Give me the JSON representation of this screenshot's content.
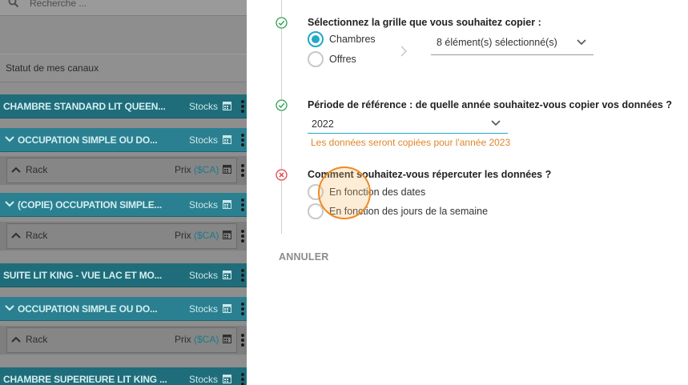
{
  "left_panel": {
    "search_placeholder": "Recherche ...",
    "status_label": "Statut de mes canaux",
    "rows": [
      {
        "kind": "room",
        "title": "CHAMBRE STANDARD LIT QUEEN...",
        "stock_label": "Stocks"
      },
      {
        "kind": "occupancy",
        "title": "OCCUPATION SIMPLE OU DO...",
        "stock_label": "Stocks"
      },
      {
        "kind": "rate",
        "label": "Rack",
        "price_label": "Prix",
        "currency": "($CA)"
      },
      {
        "kind": "occupancy",
        "title": "(COPIE) OCCUPATION SIMPLE...",
        "stock_label": "Stocks"
      },
      {
        "kind": "rate",
        "label": "Rack",
        "price_label": "Prix",
        "currency": "($CA)"
      },
      {
        "kind": "room",
        "title": "SUITE LIT KING - VUE LAC ET MO...",
        "stock_label": "Stocks"
      },
      {
        "kind": "occupancy",
        "title": "OCCUPATION SIMPLE OU DO...",
        "stock_label": "Stocks"
      },
      {
        "kind": "rate",
        "label": "Rack",
        "price_label": "Prix",
        "currency": "($CA)"
      },
      {
        "kind": "room",
        "title": "CHAMBRE SUPERIEURE LIT KING ...",
        "stock_label": "Stocks"
      }
    ]
  },
  "dialog": {
    "step1": {
      "title": "Sélectionnez la grille que vous souhaitez copier :",
      "options": [
        "Chambres",
        "Offres"
      ],
      "selected_option": "Chambres",
      "selection_value": "8 élément(s) sélectionné(s)",
      "status": "done"
    },
    "step2": {
      "title": "Période de référence : de quelle année souhaitez-vous copier vos données ?",
      "year_value": "2022",
      "hint": "Les données seront copiées pour l'année 2023",
      "status": "done"
    },
    "step3": {
      "title": "Comment souhaitez-vous répercuter les données ?",
      "options": [
        "En fonction des dates",
        "En fonction des jours de la semaine"
      ],
      "status": "error"
    },
    "cancel_label": "ANNULER"
  },
  "colors": {
    "accent": "#23a8c7",
    "success": "#2e9e4f",
    "error": "#e0434c",
    "hint": "#e0852a",
    "room_row": "#1f6d7a",
    "occupancy_row": "#2a8090"
  },
  "icons": {
    "search": "search-icon",
    "calendar": "calendar-icon",
    "kebab": "more-vert-icon",
    "check": "check-circle-icon",
    "error": "close-circle-icon"
  }
}
